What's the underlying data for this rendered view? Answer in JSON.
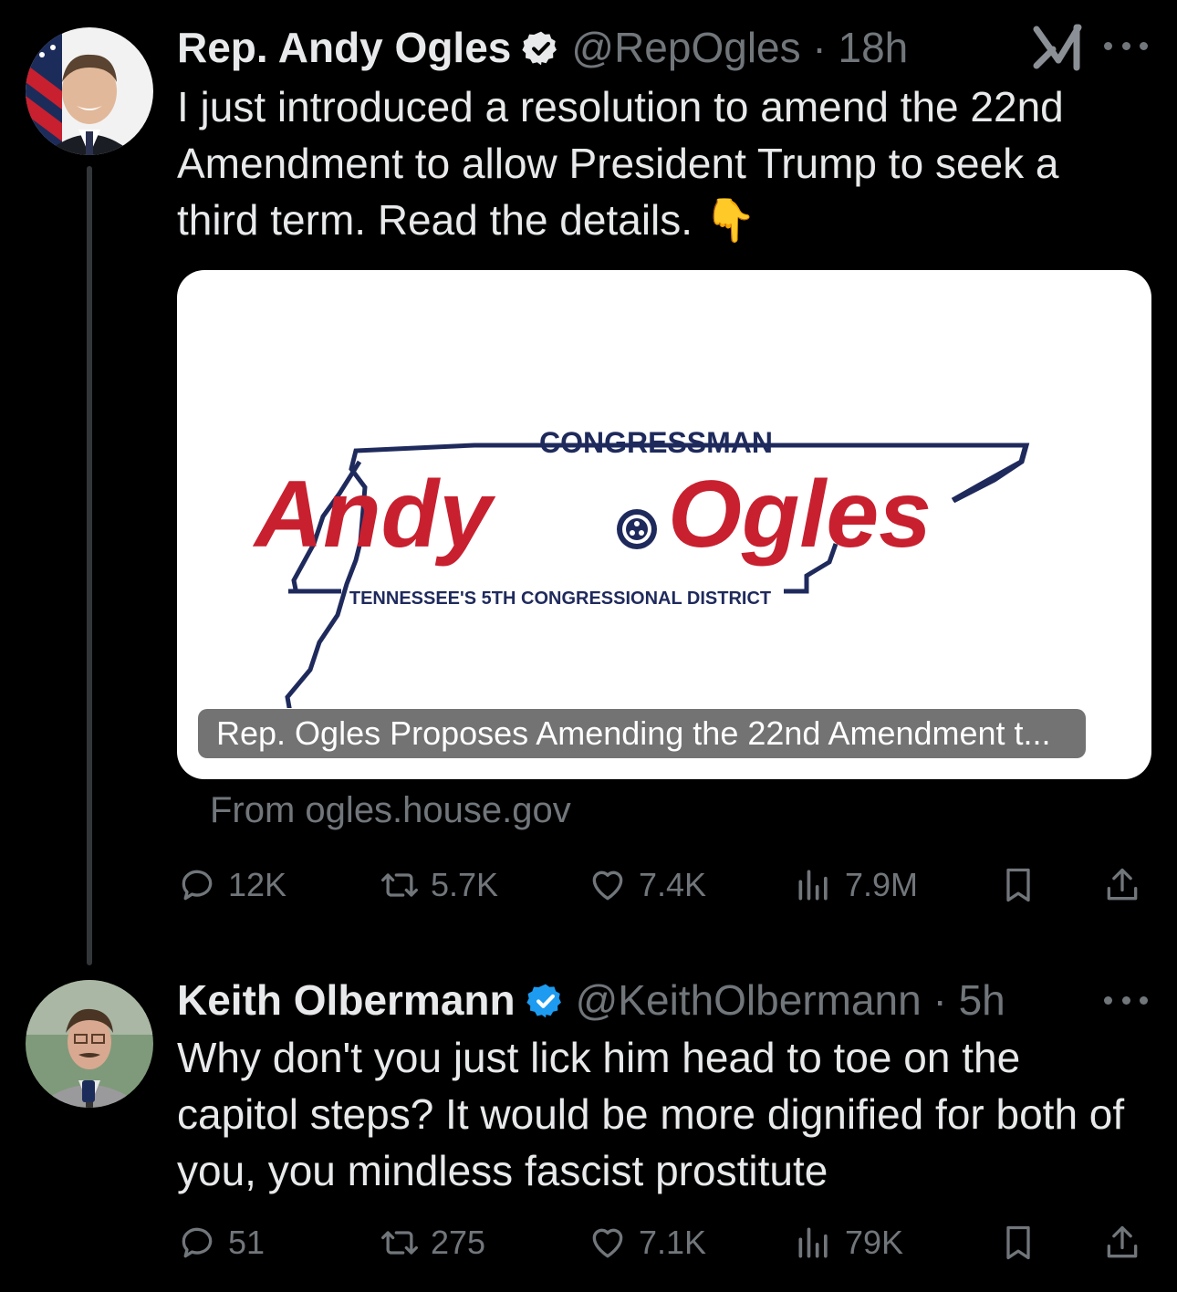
{
  "tweets": [
    {
      "name": "Rep. Andy Ogles",
      "handle": "@RepOgles",
      "time": "18h",
      "handle_time": "@RepOgles · 18h",
      "text": "I just introduced a resolution to amend the 22nd Amendment to allow President Trump to seek a third term. Read the details. 👇",
      "card": {
        "logo_top": "CONGRESSMAN",
        "logo_name_first": "Andy",
        "logo_name_last": "Ogles",
        "logo_bottom": "TENNESSEE'S 5TH CONGRESSIONAL DISTRICT",
        "title": "Rep. Ogles Proposes Amending the 22nd Amendment t...",
        "from": "From ogles.house.gov"
      },
      "stats": {
        "replies": "12K",
        "reposts": "5.7K",
        "likes": "7.4K",
        "views": "7.9M"
      }
    },
    {
      "name": "Keith Olbermann",
      "handle": "@KeithOlbermann",
      "time": "5h",
      "handle_time": "@KeithOlbermann · 5h",
      "text": "Why don't you just lick him head to toe on the capitol steps? It would be more dignified for both of you, you mindless fascist prostitute",
      "stats": {
        "replies": "51",
        "reposts": "275",
        "likes": "7.1K",
        "views": "79K"
      }
    }
  ],
  "colors": {
    "verified": "#1d9bf0",
    "muted": "#71767b",
    "logo_red": "#c8202f",
    "logo_navy": "#1f2a5c"
  },
  "icons": [
    "verified-badge-icon",
    "grok-icon",
    "more-icon",
    "reply-icon",
    "repost-icon",
    "like-icon",
    "views-icon",
    "bookmark-icon",
    "share-icon"
  ]
}
